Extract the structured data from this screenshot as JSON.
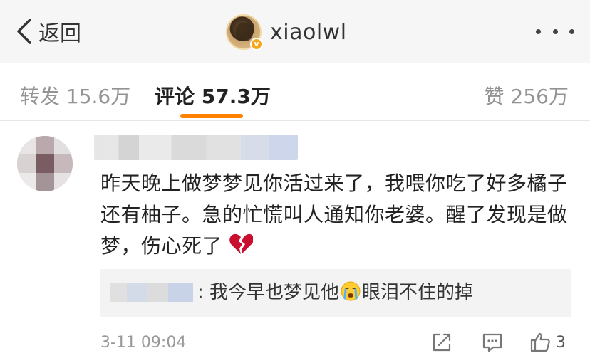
{
  "nav": {
    "back_label": "返回",
    "username": "xiaolwl",
    "verified_badge": "v"
  },
  "tabs": {
    "repost": "转发 15.6万",
    "comment": "评论 57.3万",
    "like": "赞 256万",
    "active": "comment",
    "accent_color": "#ff8200"
  },
  "comment": {
    "text": "昨天晚上做梦梦见你活过来了，我喂你吃了好多橘子还有柚子。急的忙慌叫人通知你老婆。醒了发现是做梦，伤心死了",
    "emoji": "broken-heart-icon",
    "reply": {
      "text_before": ": 我今早也梦见他",
      "emoji": "crying-face-icon",
      "text_after": "眼泪不住的掉"
    },
    "time": "3-11 09:04",
    "like_count": "3"
  }
}
